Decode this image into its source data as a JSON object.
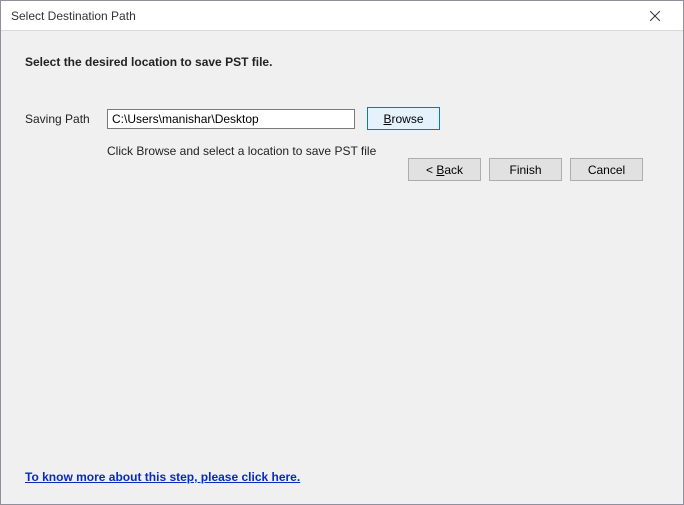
{
  "window": {
    "title": "Select Destination Path"
  },
  "content": {
    "heading": "Select the desired location to save PST file.",
    "pathLabel": "Saving Path",
    "pathValue": "C:\\Users\\manishar\\Desktop",
    "browseLabel": "rowse",
    "browseAccel": "B",
    "hint": "Click Browse and select a location to save PST file",
    "helpLink": "To know more about this step, please click here."
  },
  "footer": {
    "back": {
      "prefix": "< ",
      "accel": "B",
      "rest": "ack"
    },
    "finish": "Finish",
    "cancel": "Cancel"
  }
}
